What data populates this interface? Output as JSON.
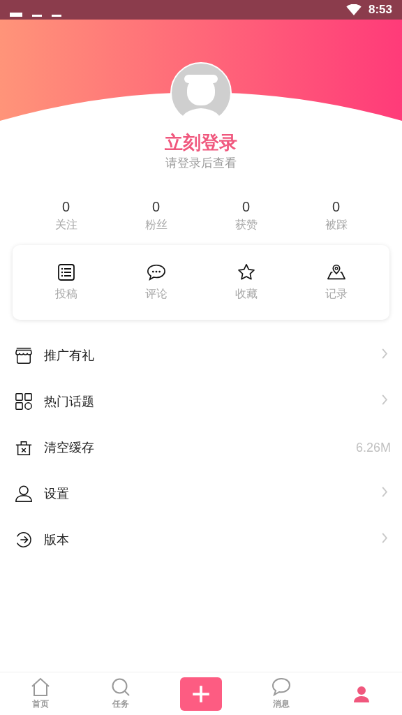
{
  "status_bar": {
    "time": "8:53"
  },
  "profile": {
    "title": "立刻登录",
    "subtitle": "请登录后查看"
  },
  "stats": [
    {
      "value": "0",
      "label": "关注"
    },
    {
      "value": "0",
      "label": "粉丝"
    },
    {
      "value": "0",
      "label": "获赞"
    },
    {
      "value": "0",
      "label": "被踩"
    }
  ],
  "shortcuts": [
    {
      "kind": "posts",
      "label": "投稿"
    },
    {
      "kind": "comments",
      "label": "评论"
    },
    {
      "kind": "favorites",
      "label": "收藏"
    },
    {
      "kind": "history",
      "label": "记录"
    }
  ],
  "menu": [
    {
      "kind": "promo",
      "label": "推广有礼",
      "chevron": true
    },
    {
      "kind": "topics",
      "label": "热门话题",
      "chevron": true
    },
    {
      "kind": "cache",
      "label": "清空缓存",
      "value": "6.26M",
      "chevron": false
    },
    {
      "kind": "settings",
      "label": "设置",
      "chevron": true
    },
    {
      "kind": "version",
      "label": "版本",
      "chevron": true
    }
  ],
  "tab_bar": [
    {
      "kind": "home",
      "label": "首页",
      "selected": false
    },
    {
      "kind": "tasks",
      "label": "任务",
      "selected": false
    },
    {
      "kind": "add",
      "selected": false
    },
    {
      "kind": "messages",
      "label": "消息",
      "selected": false
    },
    {
      "kind": "me",
      "selected": true
    }
  ]
}
